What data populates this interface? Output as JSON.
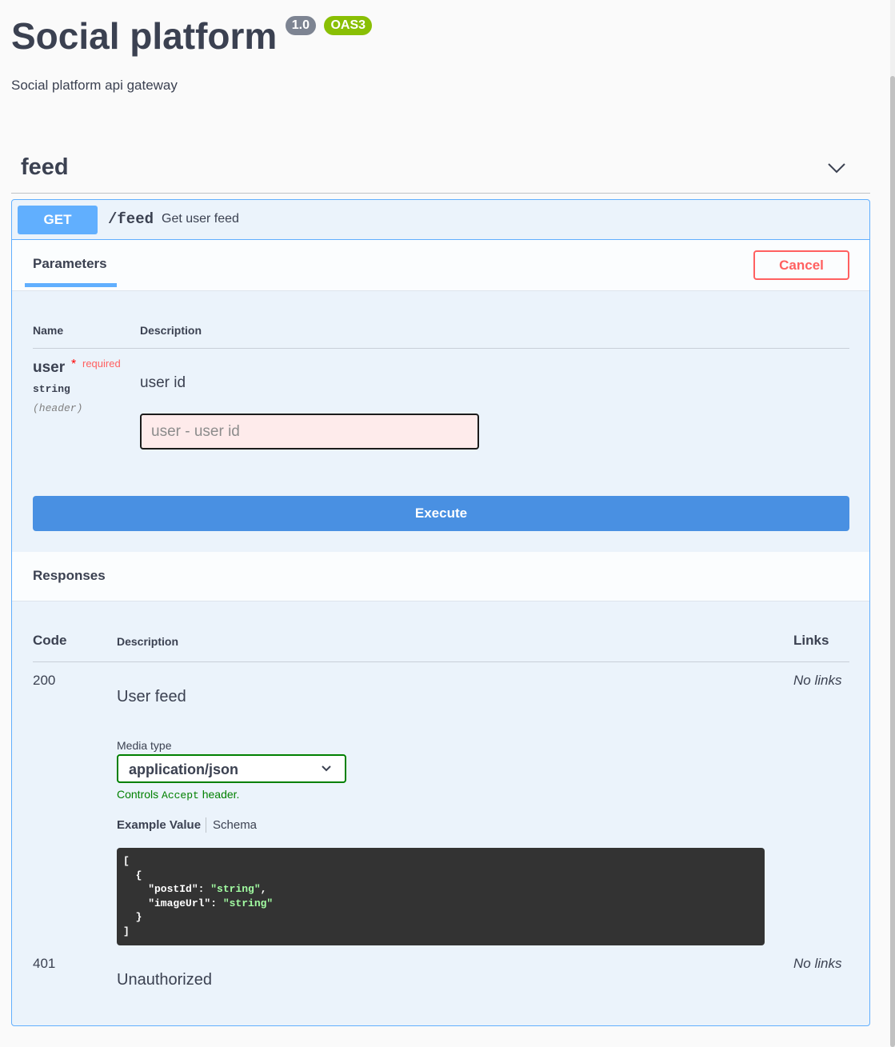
{
  "info": {
    "title": "Social platform",
    "version": "1.0",
    "oas": "OAS3",
    "description": "Social platform api gateway"
  },
  "tag": {
    "name": "feed",
    "icon": "chevron-down-icon"
  },
  "operation": {
    "method": "GET",
    "path": "/feed",
    "summary": "Get user feed",
    "method_color": "#61affe"
  },
  "parameters": {
    "tab_label": "Parameters",
    "cancel_label": "Cancel",
    "col_name": "Name",
    "col_description": "Description",
    "items": [
      {
        "name": "user",
        "required_mark": "*",
        "required_label": "required",
        "type": "string",
        "in": "(header)",
        "description": "user id",
        "placeholder": "user - user id",
        "value": ""
      }
    ]
  },
  "execute_label": "Execute",
  "responses": {
    "title": "Responses",
    "col_code": "Code",
    "col_description": "Description",
    "col_links": "Links",
    "items": [
      {
        "code": "200",
        "description": "User feed",
        "links": "No links",
        "media_type_label": "Media type",
        "media_type": "application/json",
        "controls_prefix": "Controls",
        "controls_header": "Accept",
        "controls_suffix": "header.",
        "example_tab": "Example Value",
        "schema_tab": "Schema",
        "example_lines": [
          {
            "t": "["
          },
          {
            "t": "  {"
          },
          {
            "k": "    \"postId\"",
            "sep": ": ",
            "v": "\"string\"",
            "end": ","
          },
          {
            "k": "    \"imageUrl\"",
            "sep": ": ",
            "v": "\"string\"",
            "end": ""
          },
          {
            "t": "  }"
          },
          {
            "t": "]"
          }
        ]
      },
      {
        "code": "401",
        "description": "Unauthorized",
        "links": "No links"
      }
    ]
  }
}
